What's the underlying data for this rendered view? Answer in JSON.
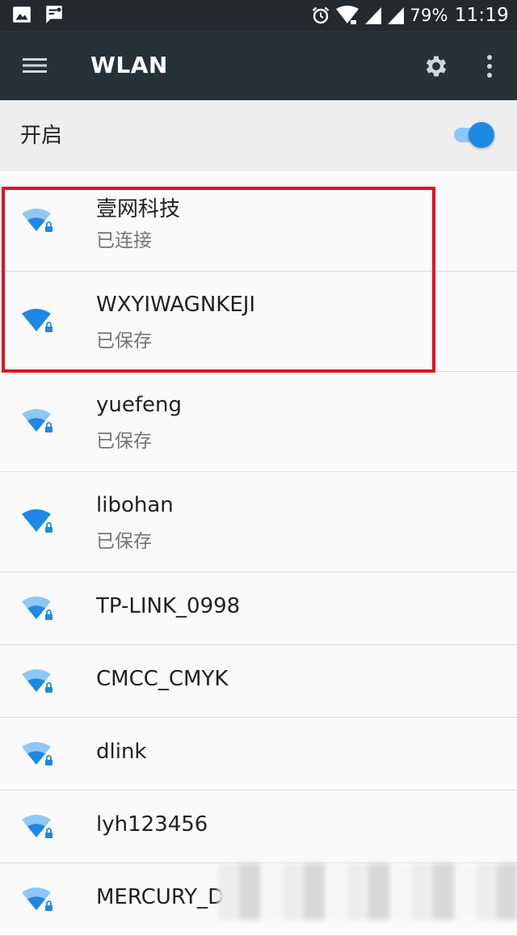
{
  "statusbar": {
    "battery": "79%",
    "time": "11:19",
    "icons": [
      "image-icon",
      "notification-icon",
      "alarm-icon",
      "wifi-signal-icon",
      "cellular-signal-icon",
      "cellular-signal-icon",
      "battery-icon"
    ]
  },
  "toolbar": {
    "title": "WLAN",
    "icons": [
      "menu-icon",
      "gear-icon",
      "more-vert-icon"
    ]
  },
  "wifi_switch": {
    "label": "开启",
    "enabled": true
  },
  "networks": [
    {
      "name": "壹网科技",
      "status": "已连接",
      "signal": "medium",
      "secured": true
    },
    {
      "name": "WXYIWAGNKEJI",
      "status": "已保存",
      "signal": "full",
      "secured": true
    },
    {
      "name": "yuefeng",
      "status": "已保存",
      "signal": "medium",
      "secured": true
    },
    {
      "name": "libohan",
      "status": "已保存",
      "signal": "full",
      "secured": true
    },
    {
      "name": "TP-LINK_0998",
      "status": "",
      "signal": "medium",
      "secured": true
    },
    {
      "name": "CMCC_CMYK",
      "status": "",
      "signal": "medium",
      "secured": true
    },
    {
      "name": "dlink",
      "status": "",
      "signal": "medium",
      "secured": true
    },
    {
      "name": "lyh123456",
      "status": "",
      "signal": "medium",
      "secured": true
    },
    {
      "name": "MERCURY_D",
      "status": "",
      "signal": "medium",
      "secured": true
    }
  ],
  "colors": {
    "toolbar": "#263238",
    "statusbar": "#24292d",
    "accent": "#1e88e5",
    "wifi_active": "#1e88e5",
    "wifi_inactive": "#8ec7f5",
    "highlight": "#e5101e"
  }
}
